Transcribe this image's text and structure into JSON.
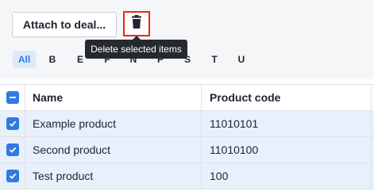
{
  "toolbar": {
    "attach_label": "Attach to deal...",
    "delete_tooltip": "Delete selected items"
  },
  "alphabet": {
    "items": [
      "All",
      "B",
      "E",
      "F",
      "N",
      "P",
      "S",
      "T",
      "U"
    ],
    "active": "All"
  },
  "table": {
    "columns": [
      "Name",
      "Product code"
    ],
    "rows": [
      {
        "name": "Example product",
        "code": "11010101",
        "selected": true
      },
      {
        "name": "Second product",
        "code": "11010100",
        "selected": true
      },
      {
        "name": "Test product",
        "code": "100",
        "selected": true
      }
    ],
    "header_checkbox_state": "indeterminate"
  },
  "colors": {
    "accent": "#317ae2",
    "highlight_border": "#e8261f",
    "selected_row_bg": "#e7f0fb",
    "tooltip_bg": "#26292e"
  },
  "icons": {
    "delete": "trash-icon",
    "row_check": "checkmark-icon",
    "header_check": "minus-icon"
  }
}
